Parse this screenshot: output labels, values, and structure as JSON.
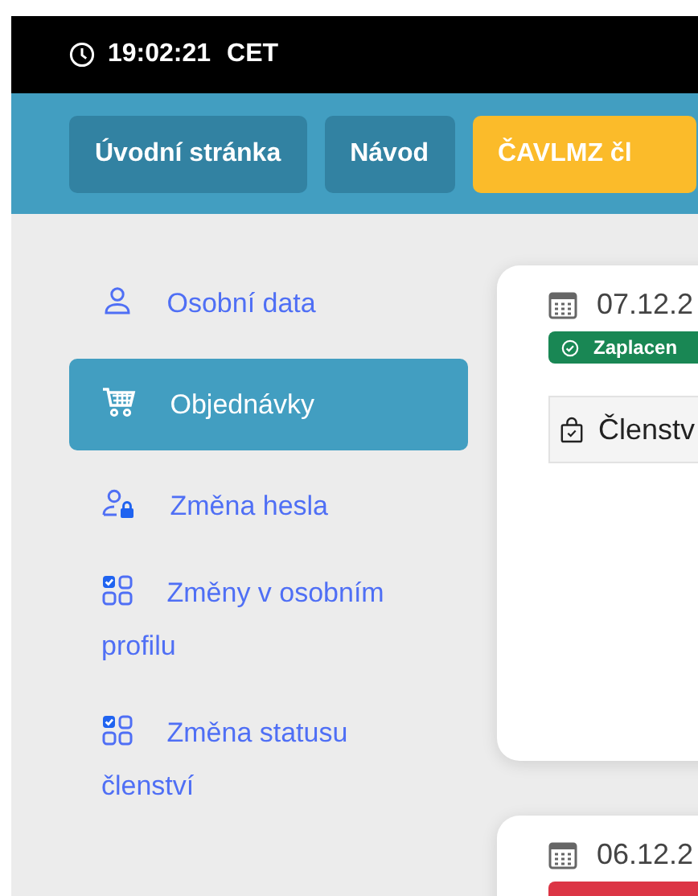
{
  "top_bar": {
    "time": "19:02:21",
    "timezone": "CET"
  },
  "nav_buttons": [
    {
      "label": "Úvodní stránka",
      "kind": "dark"
    },
    {
      "label": "Návod",
      "kind": "dark"
    },
    {
      "label": "ČAVLMZ čl",
      "kind": "accent"
    }
  ],
  "sidebar": {
    "items": [
      {
        "label": "Osobní data",
        "kind": "person",
        "selected": false
      },
      {
        "label": "Objednávky",
        "kind": "cart",
        "selected": true
      },
      {
        "label": "Změna hesla",
        "kind": "lock",
        "selected": false
      },
      {
        "label": "Změny v osobním profilu",
        "kind": "checklist",
        "selected": false
      },
      {
        "label": "Změna statusu členství",
        "kind": "checklist",
        "selected": false
      }
    ]
  },
  "orders": [
    {
      "date": "07.12.2",
      "status": {
        "label": "Zaplacen",
        "color": "#198754"
      },
      "item": "Členstv"
    },
    {
      "date": "06.12.2",
      "status": {
        "color": "#dc3545"
      }
    }
  ]
}
